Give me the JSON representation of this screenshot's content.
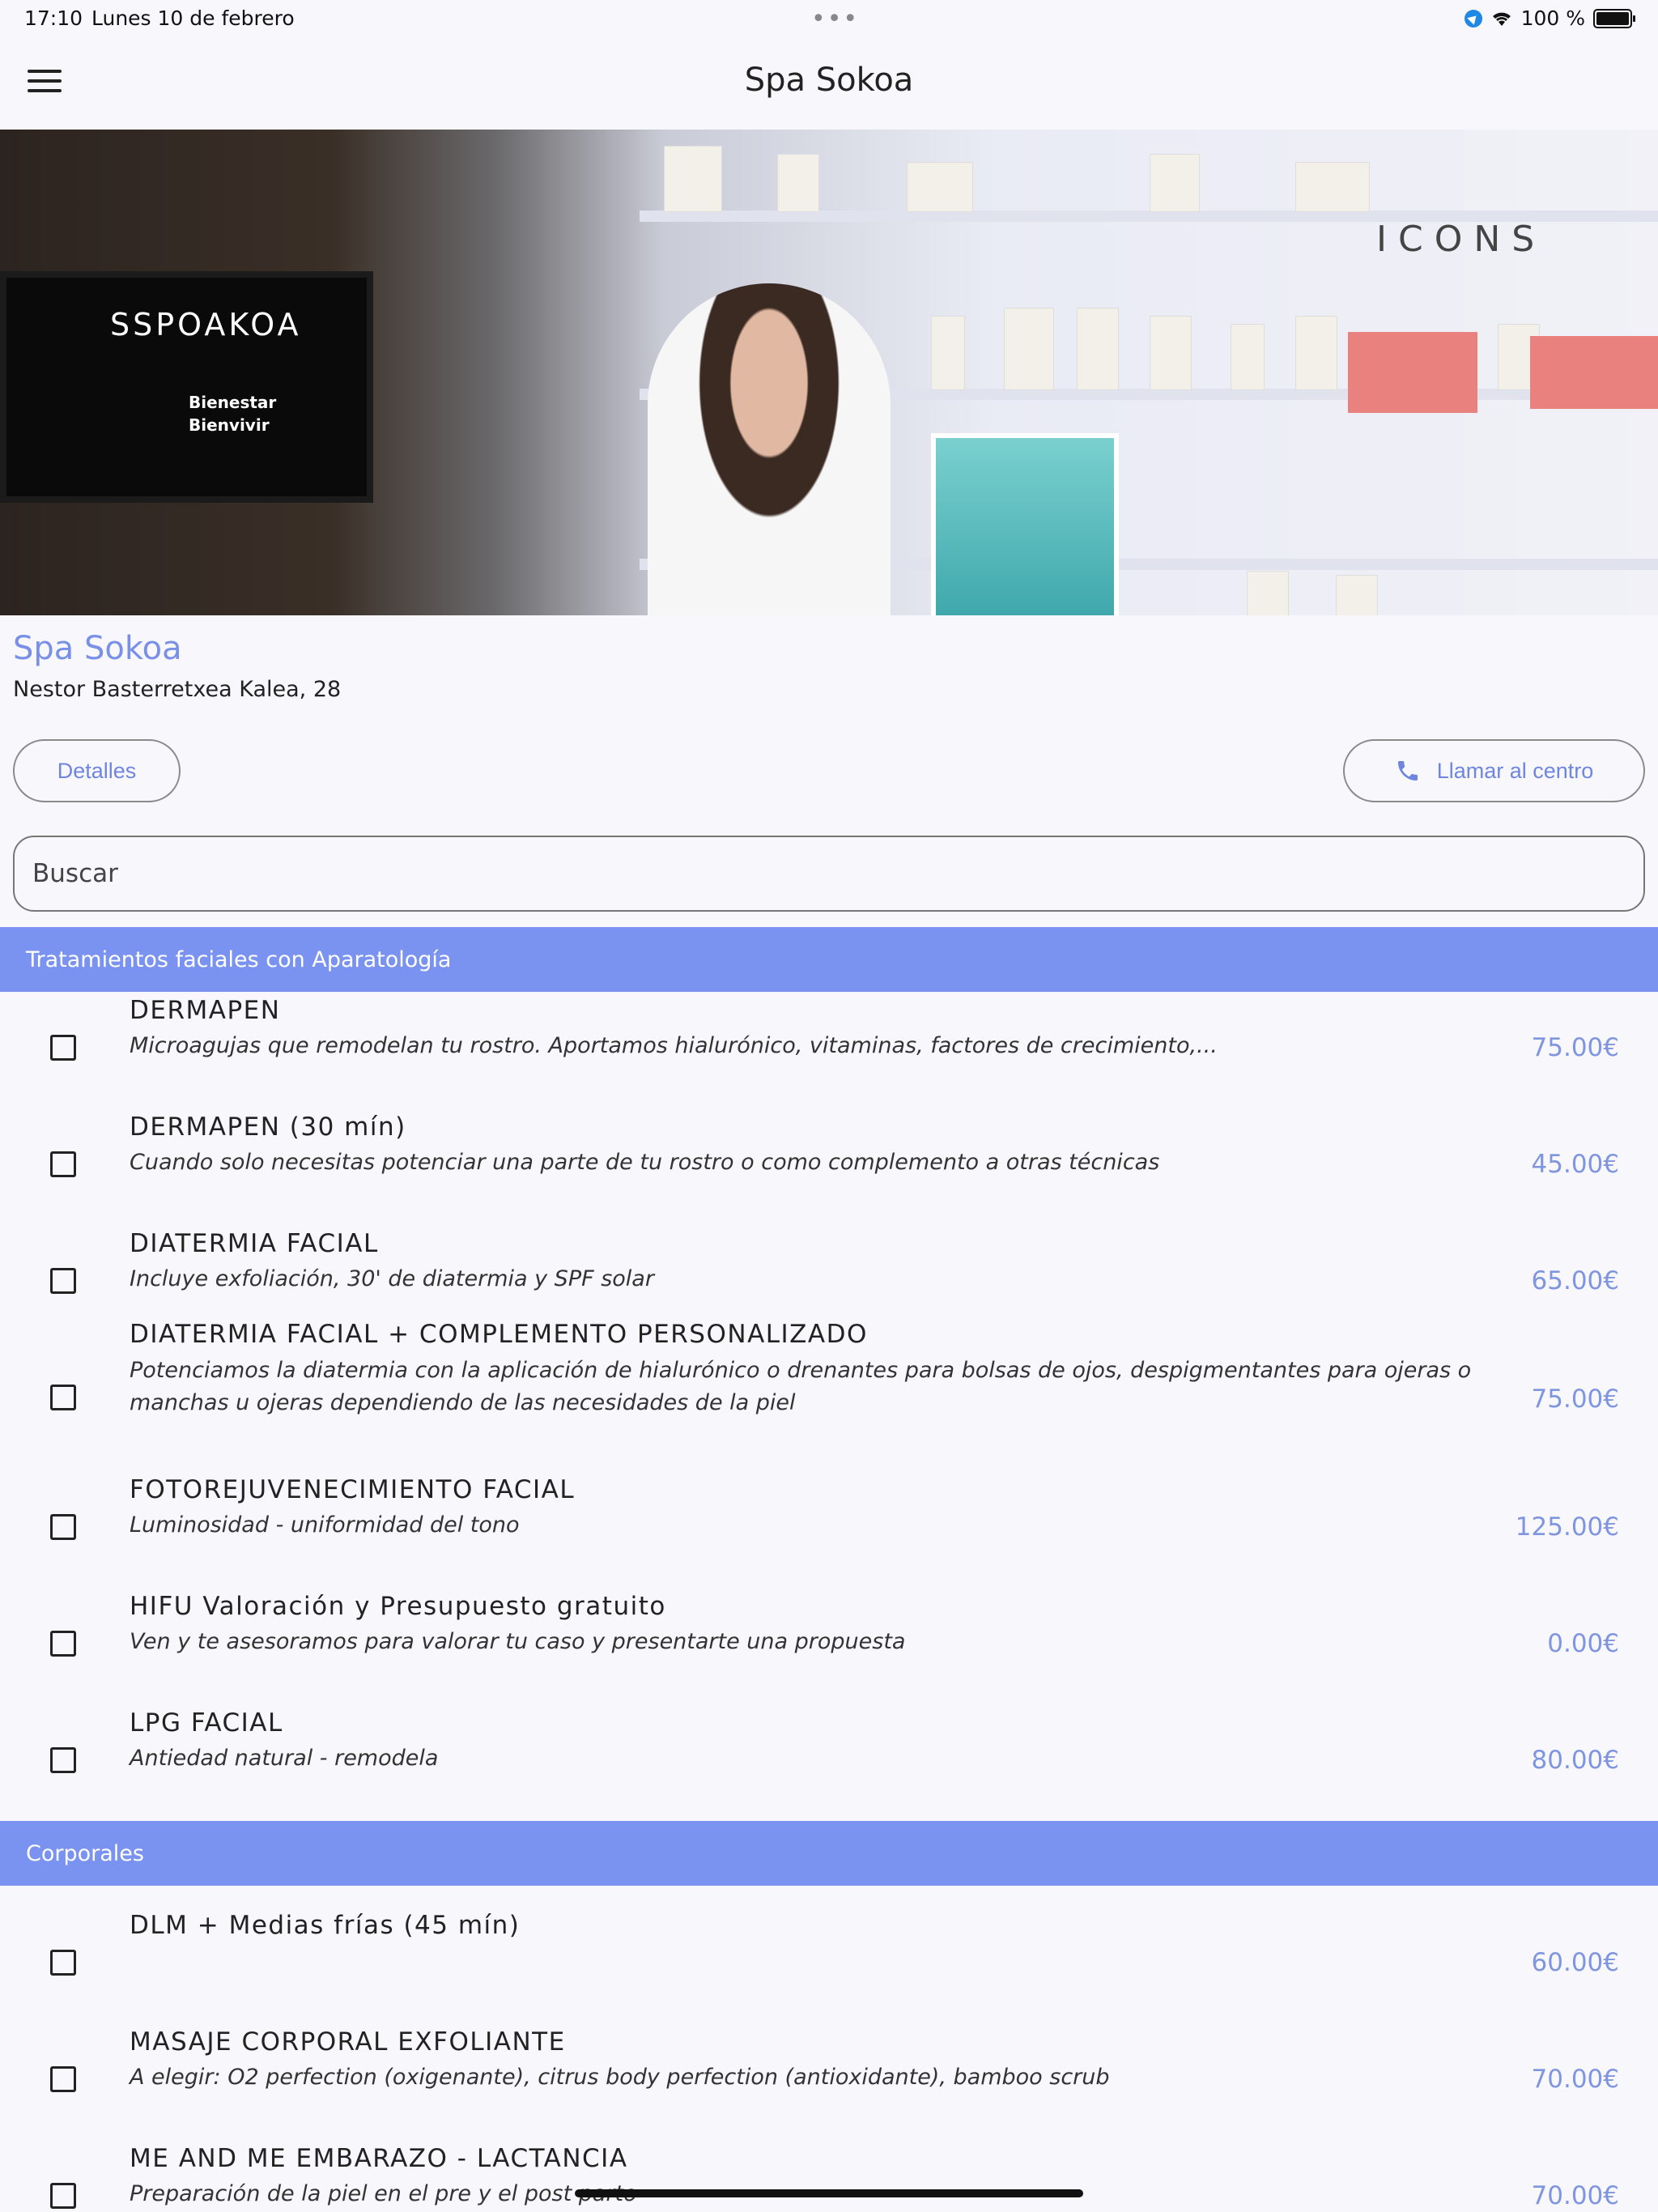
{
  "status_bar": {
    "time": "17:10",
    "date": "Lunes 10 de febrero",
    "battery": "100 %"
  },
  "header": {
    "title": "Spa Sokoa"
  },
  "hero": {
    "tv_logo": "SSPOAKOA",
    "tv_line1": "Bienestar",
    "tv_line2": "Bienvivir",
    "sign": "ICONS"
  },
  "venue": {
    "name": "Spa Sokoa",
    "address": "Nestor Basterretxea Kalea, 28"
  },
  "buttons": {
    "details": "Detalles",
    "call": "Llamar al centro"
  },
  "search": {
    "placeholder": "Buscar"
  },
  "sections": [
    {
      "title": "Tratamientos faciales con Aparatología",
      "items": [
        {
          "name": "DERMAPEN",
          "desc": "Microagujas que remodelan tu rostro. Aportamos hialurónico, vitaminas, factores de crecimiento,...",
          "price": "75.00€"
        },
        {
          "name": "DERMAPEN (30 mín)",
          "desc": "Cuando solo necesitas potenciar una parte de tu rostro o como complemento a otras técnicas",
          "price": "45.00€"
        },
        {
          "name": "DIATERMIA FACIAL",
          "desc": "Incluye exfoliación, 30' de diatermia y SPF solar",
          "price": "65.00€"
        },
        {
          "name": "DIATERMIA FACIAL + COMPLEMENTO PERSONALIZADO",
          "desc": "Potenciamos la diatermia con la aplicación de hialurónico o drenantes para bolsas de ojos, despigmentantes para ojeras o manchas u ojeras dependiendo de las necesidades de la piel",
          "price": "75.00€"
        },
        {
          "name": "FOTOREJUVENECIMIENTO FACIAL",
          "desc": "Luminosidad - uniformidad del tono",
          "price": "125.00€"
        },
        {
          "name": "HIFU Valoración y Presupuesto gratuito",
          "desc": "Ven y te asesoramos para valorar tu caso y presentarte una propuesta",
          "price": "0.00€"
        },
        {
          "name": "LPG FACIAL",
          "desc": "Antiedad natural - remodela",
          "price": "80.00€"
        }
      ]
    },
    {
      "title": "Corporales",
      "items": [
        {
          "name": "DLM + Medias frías (45 mín)",
          "desc": "",
          "price": "60.00€"
        },
        {
          "name": "MASAJE CORPORAL EXFOLIANTE",
          "desc": "A elegir: O2 perfection (oxigenante), citrus body perfection (antioxidante), bamboo scrub",
          "price": "70.00€"
        },
        {
          "name": "ME AND ME EMBARAZO - LACTANCIA",
          "desc": "Preparación de la piel en el pre y el post parto",
          "price": "70.00€"
        }
      ]
    }
  ],
  "colors": {
    "accent": "#7a93f0",
    "price": "#7f95e0",
    "background": "#f8f8fc"
  }
}
